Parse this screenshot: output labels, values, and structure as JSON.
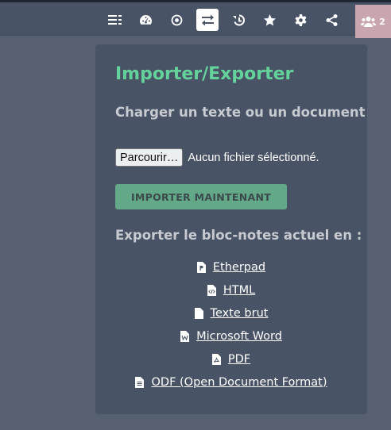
{
  "toolbar": {
    "buttons": [
      {
        "name": "menu-list-icon"
      },
      {
        "name": "dashboard-icon"
      },
      {
        "name": "aperture-icon"
      },
      {
        "name": "import-export-icon",
        "active": true
      },
      {
        "name": "history-icon"
      },
      {
        "name": "star-icon"
      },
      {
        "name": "gear-icon"
      },
      {
        "name": "share-icon"
      }
    ],
    "users_count": "2"
  },
  "import_export": {
    "title": "Importer/Exporter",
    "import_heading": "Charger un texte ou un document",
    "file_browse_label": "Parcourir…",
    "file_status": "Aucun fichier sélectionné.",
    "import_button": "IMPORTER MAINTENANT",
    "export_heading": "Exporter le bloc-notes actuel en :",
    "export_options": [
      {
        "label": "Etherpad",
        "icon": "etherpad-file-icon"
      },
      {
        "label": "HTML",
        "icon": "html-file-icon"
      },
      {
        "label": "Texte brut",
        "icon": "text-file-icon"
      },
      {
        "label": "Microsoft Word",
        "icon": "word-file-icon"
      },
      {
        "label": "PDF",
        "icon": "pdf-file-icon"
      },
      {
        "label": "ODF (Open Document Format)",
        "icon": "odf-file-icon"
      }
    ]
  },
  "colors": {
    "accent": "#64d29b",
    "panel_bg": "#485365",
    "page_bg": "#576070",
    "import_button_bg": "#64a88a",
    "users_button_bg": "#c9a5ad"
  }
}
